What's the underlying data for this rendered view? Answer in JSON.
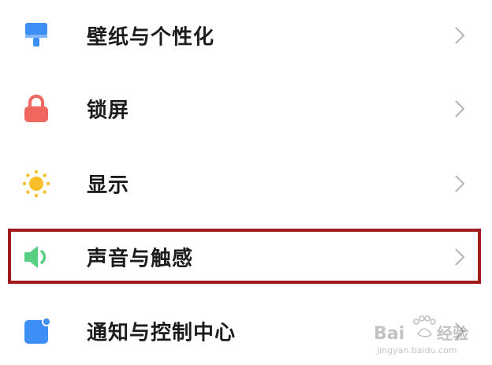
{
  "settings": {
    "items": [
      {
        "label": "壁纸与个性化",
        "icon": "wallpaper-brush-icon",
        "icon_color": "#3d8ff5"
      },
      {
        "label": "锁屏",
        "icon": "lock-icon",
        "icon_color": "#f0675f"
      },
      {
        "label": "显示",
        "icon": "sun-icon",
        "icon_color": "#f7bf2a"
      },
      {
        "label": "声音与触感",
        "icon": "speaker-icon",
        "icon_color": "#57cf82",
        "highlighted": true
      },
      {
        "label": "通知与控制中心",
        "icon": "notification-icon",
        "icon_color": "#3d8ff5"
      }
    ]
  },
  "highlight": {
    "color": "#a01c1c"
  },
  "watermark": {
    "text": "Baidu经验",
    "subtext": "jingyan.baidu.com"
  }
}
